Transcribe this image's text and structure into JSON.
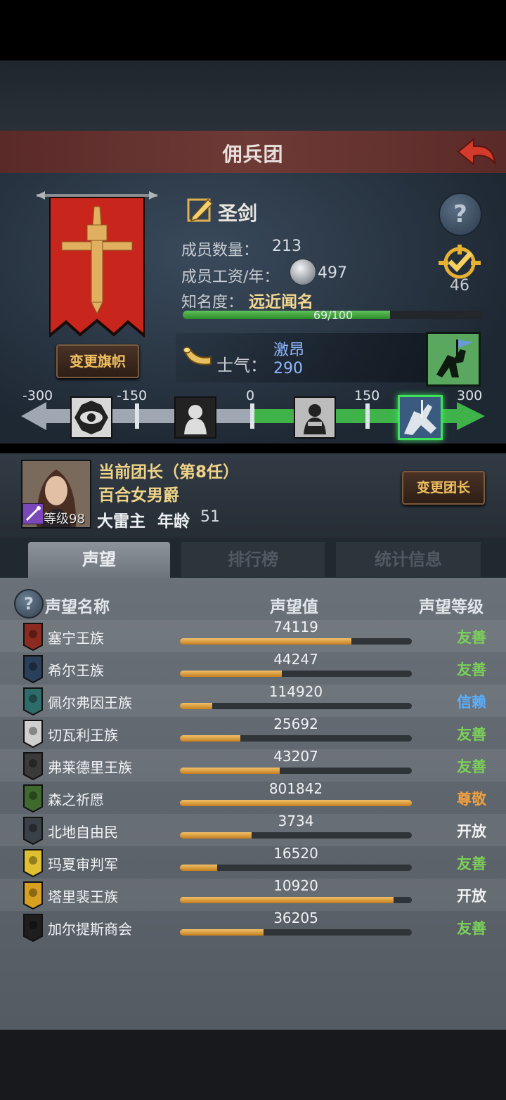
{
  "header": {
    "title": "佣兵团"
  },
  "company": {
    "name": "圣剑",
    "members_label": "成员数量：",
    "members_value": "213",
    "wage_label": "成员工资/年：",
    "wage_value": "497",
    "fame_label": "知名度：",
    "fame_value": "远近闻名",
    "fame_progress_text": "69/100",
    "fame_progress": 0.69,
    "badge_count": "46",
    "change_banner_label": "变更旗帜",
    "banner_color": "#c8261c"
  },
  "morale": {
    "label": "士气：",
    "state": "激昂",
    "value": "290",
    "scale_ticks": [
      "-300",
      "-150",
      "0",
      "150",
      "300"
    ]
  },
  "leader": {
    "title": "当前团长（第8任）",
    "rank_name": "百合女男爵",
    "name": "大雷主",
    "age_label": "年龄",
    "age": "51",
    "level_label": "等级98",
    "change_leader_label": "变更团长"
  },
  "tabs": [
    {
      "label": "声望",
      "active": true
    },
    {
      "label": "排行榜",
      "active": false
    },
    {
      "label": "统计信息",
      "active": false
    }
  ],
  "reputation": {
    "columns": [
      "声望名称",
      "声望值",
      "声望等级"
    ],
    "rows": [
      {
        "name": "塞宁王族",
        "value": "74119",
        "level": "友善",
        "progress": 0.74,
        "level_color": "#7cd05a",
        "icon_color": "#8b2a20"
      },
      {
        "name": "希尔王族",
        "value": "44247",
        "level": "友善",
        "progress": 0.44,
        "level_color": "#7cd05a",
        "icon_color": "#2a3f5a"
      },
      {
        "name": "佩尔弗因王族",
        "value": "114920",
        "level": "信赖",
        "progress": 0.14,
        "level_color": "#5ab0ff",
        "icon_color": "#2e6c6a"
      },
      {
        "name": "切瓦利王族",
        "value": "25692",
        "level": "友善",
        "progress": 0.26,
        "level_color": "#7cd05a",
        "icon_color": "#cfcfcf"
      },
      {
        "name": "弗莱德里王族",
        "value": "43207",
        "level": "友善",
        "progress": 0.43,
        "level_color": "#7cd05a",
        "icon_color": "#3a3a3a"
      },
      {
        "name": "森之祈愿",
        "value": "801842",
        "level": "尊敬",
        "progress": 1.0,
        "level_color": "#f0a040",
        "icon_color": "#3e6a2e"
      },
      {
        "name": "北地自由民",
        "value": "3734",
        "level": "开放",
        "progress": 0.31,
        "level_color": "#f2f2f2",
        "icon_color": "#3a4048"
      },
      {
        "name": "玛夏审判军",
        "value": "16520",
        "level": "友善",
        "progress": 0.16,
        "level_color": "#7cd05a",
        "icon_color": "#e0c030"
      },
      {
        "name": "塔里裴王族",
        "value": "10920",
        "level": "开放",
        "progress": 0.92,
        "level_color": "#f2f2f2",
        "icon_color": "#d8a020"
      },
      {
        "name": "加尔提斯商会",
        "value": "36205",
        "level": "友善",
        "progress": 0.36,
        "level_color": "#7cd05a",
        "icon_color": "#1e1e1e"
      }
    ]
  }
}
